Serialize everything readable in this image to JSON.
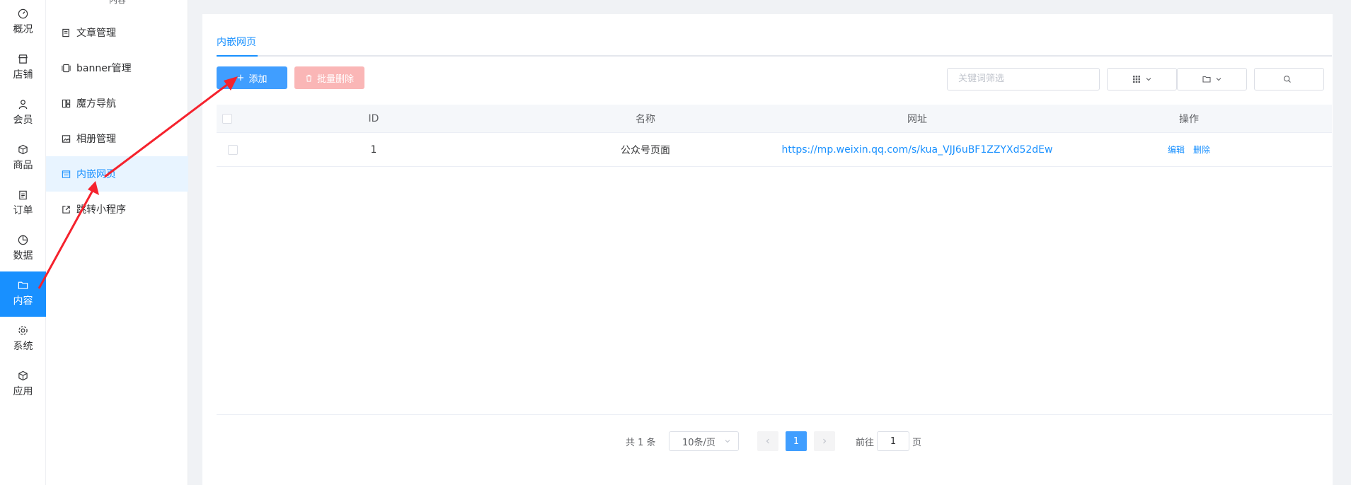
{
  "primary_nav": {
    "items": [
      {
        "label": "概况",
        "icon": "dashboard-icon"
      },
      {
        "label": "店铺",
        "icon": "store-icon"
      },
      {
        "label": "会员",
        "icon": "user-icon"
      },
      {
        "label": "商品",
        "icon": "box-icon"
      },
      {
        "label": "订单",
        "icon": "clipboard-icon"
      },
      {
        "label": "数据",
        "icon": "pie-chart-icon"
      },
      {
        "label": "内容",
        "icon": "folder-icon",
        "active": true
      },
      {
        "label": "系统",
        "icon": "gear-icon"
      },
      {
        "label": "应用",
        "icon": "cube-icon"
      }
    ]
  },
  "sub_nav": {
    "title": "内容",
    "items": [
      {
        "label": "文章管理",
        "icon": "article-icon"
      },
      {
        "label": "banner管理",
        "icon": "banner-icon"
      },
      {
        "label": "魔方导航",
        "icon": "cube-grid-icon"
      },
      {
        "label": "相册管理",
        "icon": "album-icon"
      },
      {
        "label": "内嵌网页",
        "icon": "webpage-icon",
        "active": true
      },
      {
        "label": "跳转小程序",
        "icon": "external-link-icon"
      }
    ]
  },
  "main": {
    "tab": "内嵌网页",
    "add_button": "添加",
    "batch_delete_button": "批量删除",
    "search_placeholder": "关键词筛选",
    "table": {
      "columns": [
        "ID",
        "名称",
        "网址",
        "操作"
      ],
      "rows": [
        {
          "id": "1",
          "name": "公众号页面",
          "url": "https://mp.weixin.qq.com/s/kua_VJJ6uBF1ZZYXd52dEw",
          "edit": "编辑",
          "delete": "删除"
        }
      ]
    },
    "pagination": {
      "total_text": "共 1 条",
      "page_size": "10条/页",
      "current_page": "1",
      "goto_label": "前往",
      "goto_value": "1",
      "page_unit": "页"
    }
  },
  "colors": {
    "primary": "#1890ff",
    "button_blue": "#409eff",
    "danger_disabled": "#fab6b6",
    "annotation_arrow": "#f5222d"
  }
}
